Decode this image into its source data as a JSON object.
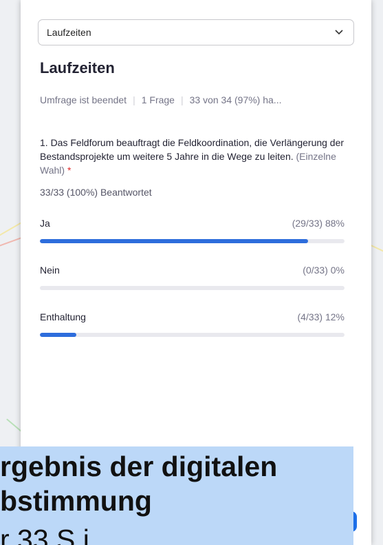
{
  "poll_select": {
    "value": "Laufzeiten",
    "icon": "chevron-down-icon"
  },
  "poll": {
    "title": "Laufzeiten",
    "meta": {
      "status": "Umfrage ist beendet",
      "questions": "1 Frage",
      "participation": "33 von 34 (97%) ha..."
    },
    "question": {
      "text": "1. Das Feldforum beauftragt die Feldkoordination, die Verlängerung der Bestandsprojekte um weitere    5 Jahre in die Wege zu leiten.",
      "type": "(Einzelne Wahl)",
      "required_mark": "*",
      "answered": "33/33 (100%) Beantwortet"
    },
    "options": [
      {
        "label": "Ja",
        "stat": "(29/33) 88%",
        "fraction": 0.88
      },
      {
        "label": "Nein",
        "stat": "(0/33) 0%",
        "fraction": 0.0
      },
      {
        "label": "Enthaltung",
        "stat": "(4/33) 12%",
        "fraction": 0.12
      }
    ]
  },
  "caption": {
    "line1": "rgebnis der digitalen",
    "line2": "bstimmung",
    "line3": "r 33 S i"
  },
  "colors": {
    "accent": "#2d6ddc",
    "caption_bg": "#bcd8f8",
    "required": "#e02828"
  }
}
